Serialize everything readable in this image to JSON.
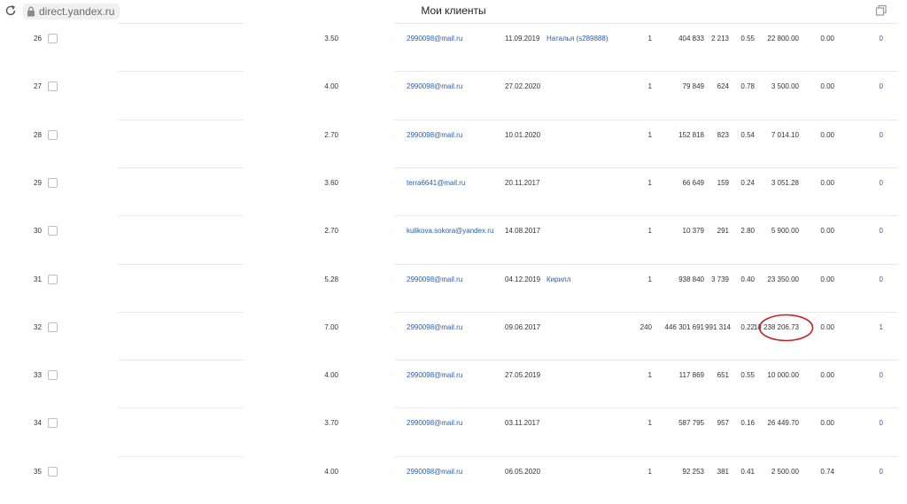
{
  "browser": {
    "url": "direct.yandex.ru",
    "page_title": "Мои клиенты"
  },
  "icons": {
    "reload": "reload-icon",
    "lock": "lock-icon",
    "window": "window-icon"
  },
  "colors": {
    "link": "#2a5db0",
    "highlight": "#cc1f1f"
  },
  "rows": [
    {
      "num": "26",
      "rating": "3.50",
      "email": "2990098@mail.ru",
      "date": "11.09.2019",
      "manager": "Наталья (s289888)",
      "count": "1",
      "shows": "404 833",
      "clicks": "2 213",
      "ctr": "0.55",
      "spend": "22 800.00",
      "zero": "0.00",
      "end": "0"
    },
    {
      "num": "27",
      "rating": "4.00",
      "email": "2990098@mail.ru",
      "date": "27.02.2020",
      "manager": "",
      "count": "1",
      "shows": "79 849",
      "clicks": "624",
      "ctr": "0.78",
      "spend": "3 500.00",
      "zero": "0.00",
      "end": "0"
    },
    {
      "num": "28",
      "rating": "2.70",
      "email": "2990098@mail.ru",
      "date": "10.01.2020",
      "manager": "",
      "count": "1",
      "shows": "152 818",
      "clicks": "823",
      "ctr": "0.54",
      "spend": "7 014.10",
      "zero": "0.00",
      "end": "0"
    },
    {
      "num": "29",
      "rating": "3.60",
      "email": "terra6641@mail.ru",
      "date": "20.11.2017",
      "manager": "",
      "count": "1",
      "shows": "66 649",
      "clicks": "159",
      "ctr": "0.24",
      "spend": "3 051.28",
      "zero": "0.00",
      "end": "0"
    },
    {
      "num": "30",
      "rating": "2.70",
      "email": "kulikova.sokora@yandex.ru",
      "date": "14.08.2017",
      "manager": "",
      "count": "1",
      "shows": "10 379",
      "clicks": "291",
      "ctr": "2.80",
      "spend": "5 900.00",
      "zero": "0.00",
      "end": "0"
    },
    {
      "num": "31",
      "rating": "5.28",
      "email": "2990098@mail.ru",
      "date": "04.12.2019",
      "manager": "Кирилл",
      "count": "1",
      "shows": "938 840",
      "clicks": "3 739",
      "ctr": "0.40",
      "spend": "23 350.00",
      "zero": "0.00",
      "end": "0"
    },
    {
      "num": "32",
      "rating": "7.00",
      "email": "2990098@mail.ru",
      "date": "09.06.2017",
      "manager": "",
      "count": "240",
      "shows": "446 301 691",
      "clicks": "991 314",
      "ctr": "0.22",
      "spend": "18 238 206.73",
      "zero": "0.00",
      "end": "1"
    },
    {
      "num": "33",
      "rating": "4.00",
      "email": "2990098@mail.ru",
      "date": "27.05.2019",
      "manager": "",
      "count": "1",
      "shows": "117 869",
      "clicks": "651",
      "ctr": "0.55",
      "spend": "10 000.00",
      "zero": "0.00",
      "end": "0"
    },
    {
      "num": "34",
      "rating": "3.70",
      "email": "2990098@mail.ru",
      "date": "03.11.2017",
      "manager": "",
      "count": "1",
      "shows": "587 795",
      "clicks": "957",
      "ctr": "0.16",
      "spend": "26 449.70",
      "zero": "0.00",
      "end": "0"
    },
    {
      "num": "35",
      "rating": "4.00",
      "email": "2990098@mail.ru",
      "date": "06.05.2020",
      "manager": "",
      "count": "1",
      "shows": "92 253",
      "clicks": "381",
      "ctr": "0.41",
      "spend": "2 500.00",
      "zero": "0.74",
      "end": "0"
    }
  ]
}
